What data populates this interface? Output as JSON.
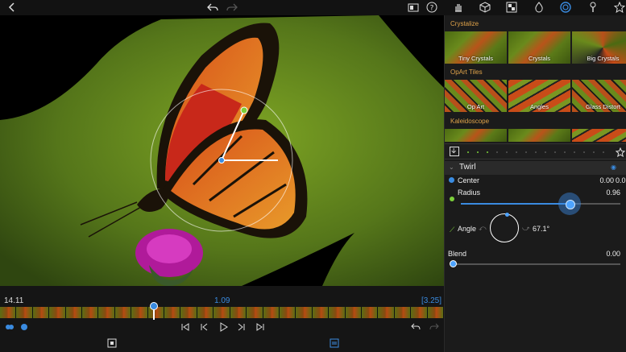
{
  "app": {
    "accent": "#3a8be0",
    "category_color": "#e0a34a"
  },
  "topbar": {
    "left_icons": [
      "back-icon"
    ],
    "center_icons": [
      "undo-icon",
      "redo-icon"
    ],
    "right_icons": [
      "compare-icon",
      "help-icon",
      "hand-icon",
      "cube-icon",
      "layers-icon",
      "drop-icon",
      "effects-icon",
      "brush-icon",
      "star-icon"
    ]
  },
  "effects_panel": {
    "categories": [
      {
        "title": "Crystalize",
        "items": [
          "Tiny Crystals",
          "Crystals",
          "Big Crystals"
        ]
      },
      {
        "title": "OpArt Tiles",
        "items": [
          "Op Art",
          "Angles",
          "Glass Distort"
        ]
      },
      {
        "title": "Kaleidoscope",
        "items": [
          "",
          "",
          ""
        ]
      }
    ],
    "effect": {
      "name": "Twirl",
      "center_label": "Center",
      "center_x": "0.00",
      "center_y": "0.0",
      "radius_label": "Radius",
      "radius_value": "0.96",
      "radius_fraction": 0.96,
      "angle_label": "Angle",
      "angle_value": "67.1°",
      "angle_degrees": 67.1,
      "blend_label": "Blend",
      "blend_value": "0.00",
      "blend_fraction": 0.0
    }
  },
  "timeline": {
    "current_time": "14.11",
    "marker_time": "1.09",
    "duration": "[3.25]"
  }
}
